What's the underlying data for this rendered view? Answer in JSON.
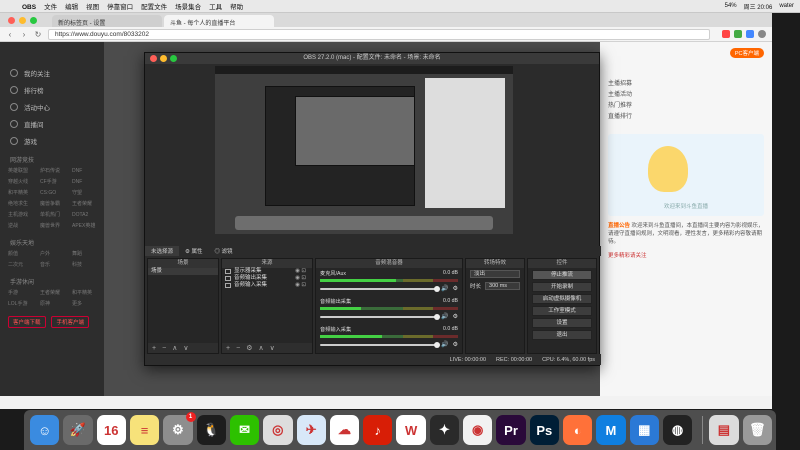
{
  "menubar": {
    "apple": "",
    "items": [
      "OBS",
      "文件",
      "编辑",
      "视图",
      "停靠窗口",
      "配置文件",
      "场景集合",
      "工具",
      "帮助"
    ],
    "status_right": [
      "54%",
      "周三 20:06",
      "water"
    ]
  },
  "browser": {
    "tabs": [
      "新的标签页 - 设置",
      "斗鱼 - 每个人的直播平台"
    ],
    "url": "https://www.douyu.com/8033202",
    "bookmarks": [
      "手机收藏夹",
      "直播 · 中国",
      "我的关注",
      "百度地图",
      "B站游戏_pc",
      "电影网_高",
      "腾讯视频_p",
      "V秒网_",
      "CCTV-5综",
      "CCTV5",
      "Free Stock",
      "神诞视频网",
      "盈采网",
      "片资网",
      "字幕库",
      "中国高清网",
      "CK电影网",
      "在线视频",
      "幻海工作"
    ]
  },
  "page": {
    "nav_items": [
      "我的关注",
      "排行榜",
      "活动中心",
      "直播间",
      "游戏"
    ],
    "categories_caption": "网游竞技",
    "categories": [
      "英雄联盟",
      "炉石传说",
      "DNF",
      "穿越火线",
      "CF手游",
      "DNF",
      "和平精英",
      "CS:GO",
      "守望",
      "绝地求生",
      "魔兽争霸",
      "王者荣耀",
      "主机游戏",
      "单机热门",
      "DOTA2",
      "逆战",
      "魔兽世界",
      "APEX英雄"
    ],
    "categories2_caption": "娱乐天地",
    "categories2": [
      "颜值",
      "户外",
      "舞蹈",
      "二次元",
      "音乐",
      "科技"
    ],
    "categories3_caption": "手游休闲",
    "categories3": [
      "手游",
      "王者荣耀",
      "和平精英",
      "LOL手游",
      "原神",
      "更多"
    ],
    "left_buttons": [
      "客户端下载",
      "手机客户端"
    ],
    "right_panel": {
      "pc_label": "PC客户端",
      "links": [
        "主播招募",
        "主播活动",
        "热门推荐",
        "直播排行"
      ],
      "banner_text": "欢迎来到斗鱼直播",
      "note_title": "直播公告",
      "note_text": "欢迎来到斗鱼直播间，本直播间主要内容为影视娱乐，请遵守直播间规则，文明观看，理性发言，更多精彩内容敬请期待。",
      "note_link": "更多精彩请关注"
    }
  },
  "obs": {
    "title": "OBS 27.2.0 (mac) - 配置文件: 未命名 - 场景: 未命名",
    "tabs": [
      "未选择源",
      "属性",
      "滤镜"
    ],
    "docks": {
      "scenes": {
        "title": "场景",
        "items": [
          "场景"
        ]
      },
      "sources": {
        "title": "来源",
        "items": [
          "显示器采集",
          "音频输出采集",
          "音频输入采集"
        ]
      },
      "mixer": {
        "title": "音频混音器",
        "channels": [
          {
            "name": "麦克风/Aux",
            "db": "0.0 dB",
            "level": 0.55
          },
          {
            "name": "音频输出采集",
            "db": "0.0 dB",
            "level": 0.3
          },
          {
            "name": "音频输入采集",
            "db": "0.0 dB",
            "level": 0.45
          }
        ]
      },
      "transitions": {
        "title": "转场特效",
        "type": "淡出",
        "duration_label": "时长",
        "duration": "300 ms"
      },
      "controls": {
        "title": "控件",
        "buttons": [
          "停止推流",
          "开始录制",
          "启动虚拟摄像机",
          "工作室模式",
          "设置",
          "退出"
        ]
      }
    },
    "status": {
      "live": "LIVE: 00:00:00",
      "rec": "REC: 00:00:00",
      "cpu": "CPU: 6.4%, 60.00 fps"
    }
  },
  "dock_apps": [
    {
      "name": "Finder",
      "color": "#3a8be0",
      "glyph": "☺"
    },
    {
      "name": "Launchpad",
      "color": "#6a6a6a",
      "glyph": "🚀"
    },
    {
      "name": "Calendar",
      "color": "#ffffff",
      "glyph": "16"
    },
    {
      "name": "Notes",
      "color": "#f7e27a",
      "glyph": "≡"
    },
    {
      "name": "System Preferences",
      "color": "#8e8e8e",
      "glyph": "⚙",
      "badge": "1"
    },
    {
      "name": "QQ",
      "color": "#1d1d1d",
      "glyph": "🐧"
    },
    {
      "name": "WeChat",
      "color": "#2dc100",
      "glyph": "✉"
    },
    {
      "name": "Screenshot",
      "color": "#dddddd",
      "glyph": "◎"
    },
    {
      "name": "Mail",
      "color": "#d8e8f8",
      "glyph": "✈"
    },
    {
      "name": "Baidu Netdisk",
      "color": "#ffffff",
      "glyph": "☁"
    },
    {
      "name": "NetEase Music",
      "color": "#d81e06",
      "glyph": "♪"
    },
    {
      "name": "WPS",
      "color": "#ffffff",
      "glyph": "W"
    },
    {
      "name": "Final Cut",
      "color": "#2a2a2a",
      "glyph": "✦"
    },
    {
      "name": "Chrome",
      "color": "#f2f2f2",
      "glyph": "◉"
    },
    {
      "name": "Premiere",
      "color": "#2a0a3a",
      "glyph": "Pr"
    },
    {
      "name": "Photoshop",
      "color": "#001e36",
      "glyph": "Ps"
    },
    {
      "name": "Firefox",
      "color": "#ff7139",
      "glyph": "◐"
    },
    {
      "name": "Maps",
      "color": "#0f7fe0",
      "glyph": "M"
    },
    {
      "name": "Movie",
      "color": "#2b79d6",
      "glyph": "▦"
    },
    {
      "name": "OBS",
      "color": "#222222",
      "glyph": "◍"
    }
  ],
  "dock_right": [
    {
      "name": "Document",
      "color": "#dcdcdc",
      "glyph": "▤"
    },
    {
      "name": "Trash",
      "color": "#9a9a9a",
      "glyph": "🗑"
    }
  ]
}
